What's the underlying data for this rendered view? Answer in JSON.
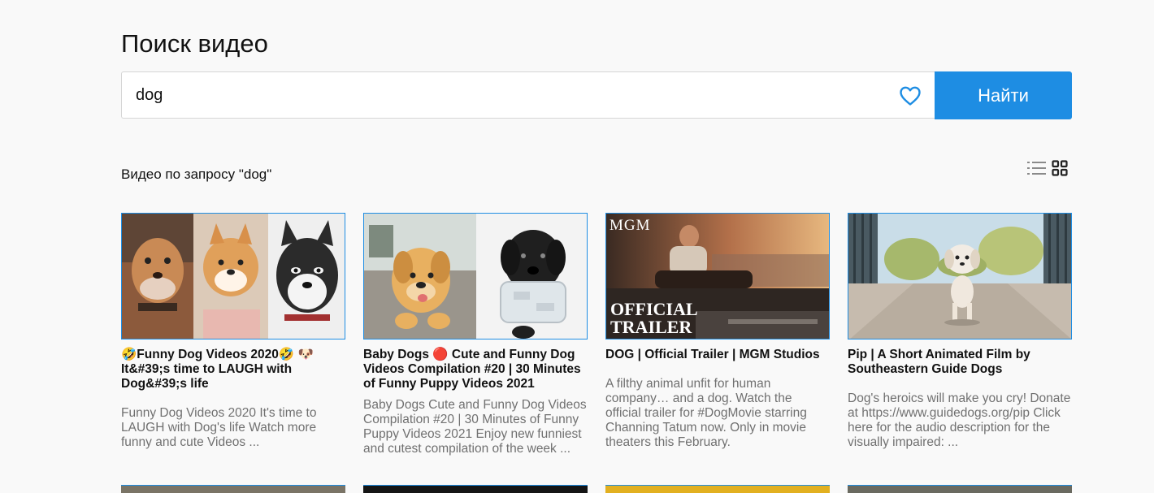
{
  "page": {
    "title": "Поиск видео"
  },
  "search": {
    "value": "dog",
    "button_label": "Найти"
  },
  "results": {
    "heading": "Видео по запросу \"dog\"",
    "videos": [
      {
        "title": "🤣Funny Dog Videos 2020🤣 🐶 It&#39;s time to LAUGH with Dog&#39;s life",
        "description": "Funny Dog Videos 2020 It's time to LAUGH with Dog's life Watch more funny and cute Videos ..."
      },
      {
        "title": "Baby Dogs 🔴 Cute and Funny Dog Videos Compilation #20 | 30 Minutes of Funny Puppy Videos 2021",
        "description": "Baby Dogs Cute and Funny Dog Videos Compilation #20 | 30 Minutes of Funny Puppy Videos 2021 Enjoy new funniest and cutest compilation of the week ..."
      },
      {
        "title": "DOG | Official Trailer | MGM Studios",
        "description": "A filthy animal unfit for human company… and a dog. Watch the official trailer for #DogMovie starring Channing Tatum now. Only in movie theaters this February.",
        "thumb_text": {
          "brand": "MGM",
          "line1": "OFFICIAL",
          "line2": "TRAILER"
        }
      },
      {
        "title": "Pip | A Short Animated Film by Southeastern Guide Dogs",
        "description": "Dog's heroics will make you cry! Donate at https://www.guidedogs.org/pip Click here for the audio description for the visually impaired: ..."
      }
    ]
  },
  "colors": {
    "accent": "#1e8de3",
    "background": "#f9f9f9",
    "muted_text": "#707070"
  },
  "icons": {
    "favorite": "heart-icon",
    "list_view": "list-view-icon",
    "grid_view": "grid-view-icon"
  }
}
